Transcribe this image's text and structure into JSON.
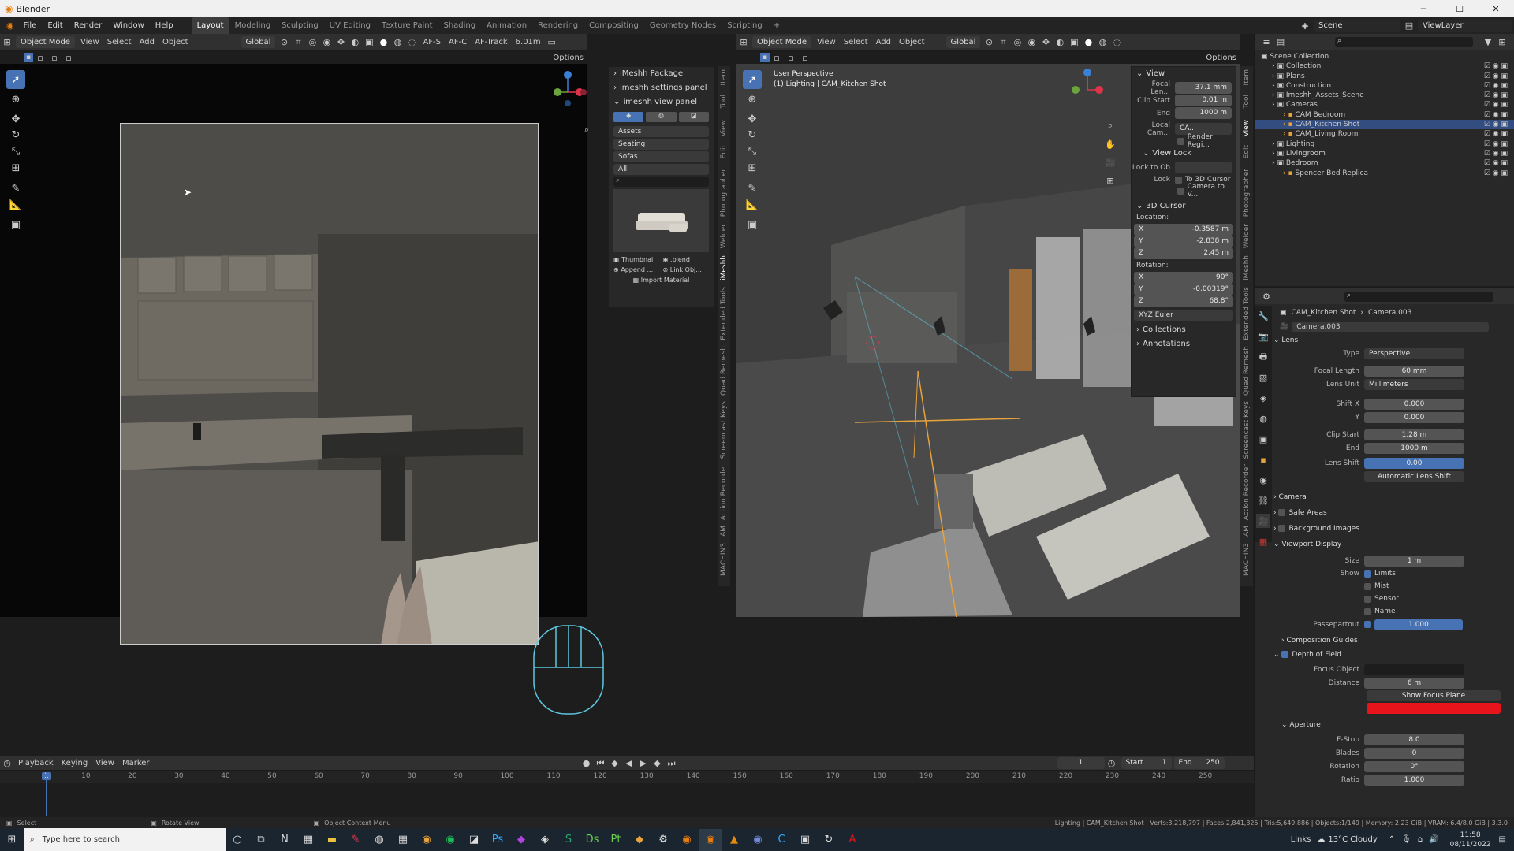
{
  "titlebar": {
    "title": "Blender"
  },
  "menu": [
    "File",
    "Edit",
    "Render",
    "Window",
    "Help"
  ],
  "workspaces": [
    "Layout",
    "Modeling",
    "Sculpting",
    "UV Editing",
    "Texture Paint",
    "Shading",
    "Animation",
    "Rendering",
    "Compositing",
    "Geometry Nodes",
    "Scripting"
  ],
  "active_workspace": "Layout",
  "scene": {
    "name": "Scene",
    "view_layer": "ViewLayer"
  },
  "left_view": {
    "mode": "Object Mode",
    "menus": [
      "View",
      "Select",
      "Add",
      "Object"
    ],
    "transform": "Global",
    "af_labels": [
      "AF-S",
      "AF-C",
      "AF-Track"
    ],
    "af_distance": "6.01m",
    "options": "Options"
  },
  "imeshh": {
    "package": "iMeshh Package",
    "settings": "imeshh settings panel",
    "view_panel": "imeshh view panel",
    "dropdowns": [
      "Assets",
      "Seating",
      "Sofas",
      "All"
    ],
    "thumbnail": "Thumbnail",
    "blend": ".blend",
    "append": "Append ...",
    "link": "Link Obj...",
    "import": "Import Material"
  },
  "left_vtabs": [
    "Item",
    "Tool",
    "View",
    "Edit",
    "Photographer",
    "Welder",
    "iMeshh",
    "Extended Tools",
    "Quad Remesh",
    "Screencast Keys",
    "Action Recorder",
    "AM",
    "MACHIN3"
  ],
  "right_view": {
    "mode": "Object Mode",
    "menus": [
      "View",
      "Select",
      "Add",
      "Object"
    ],
    "transform": "Global",
    "options": "Options",
    "overlay_title": "User Perspective",
    "overlay_sub": "(1) Lighting | CAM_Kitchen Shot"
  },
  "view_panel": {
    "view": "View",
    "focal_label": "Focal Len...",
    "focal": "37.1 mm",
    "clip_start_label": "Clip Start",
    "clip_start": "0.01 m",
    "end_label": "End",
    "end": "1000 m",
    "local_cam": "Local Cam...",
    "local_cam_val": "CA...",
    "render_region": "Render Regi...",
    "view_lock": "View Lock",
    "lock_to_obj": "Lock to Ob",
    "lock": "Lock",
    "to_3d_cursor": "To 3D Cursor",
    "camera_to_view": "Camera to V...",
    "cursor": "3D Cursor",
    "location": "Location:",
    "loc_x": "-0.3587 m",
    "loc_y": "-2.838 m",
    "loc_z": "2.45 m",
    "rotation": "Rotation:",
    "rot_x": "90°",
    "rot_y": "-0.00319°",
    "rot_z": "68.8°",
    "euler": "XYZ Euler",
    "collections": "Collections",
    "annotations": "Annotations"
  },
  "right_vtabs": [
    "Item",
    "Tool",
    "View",
    "Edit",
    "Photographer",
    "Welder",
    "iMeshh",
    "Extended Tools",
    "Quad Remesh",
    "Screencast Keys",
    "Action Recorder",
    "AM",
    "MACHIN3"
  ],
  "outliner": {
    "root": "Scene Collection",
    "rows": [
      {
        "label": "Collection",
        "indent": 1
      },
      {
        "label": "Plans",
        "indent": 1
      },
      {
        "label": "Construction",
        "indent": 1
      },
      {
        "label": "Imeshh_Assets_Scene",
        "indent": 1
      },
      {
        "label": "Cameras",
        "indent": 1
      },
      {
        "label": "CAM Bedroom",
        "indent": 2
      },
      {
        "label": "CAM_Kitchen Shot",
        "indent": 2
      },
      {
        "label": "CAM_Living Room",
        "indent": 2
      },
      {
        "label": "Lighting",
        "indent": 1
      },
      {
        "label": "Livingroom",
        "indent": 1
      },
      {
        "label": "Bedroom",
        "indent": 1
      },
      {
        "label": "Spencer Bed Replica",
        "indent": 2
      }
    ]
  },
  "properties": {
    "breadcrumb_obj": "CAM_Kitchen Shot",
    "breadcrumb_data": "Camera.003",
    "data_name": "Camera.003",
    "lens": "Lens",
    "type_label": "Type",
    "type": "Perspective",
    "focal_label": "Focal Length",
    "focal": "60 mm",
    "lens_unit_label": "Lens Unit",
    "lens_unit": "Millimeters",
    "shift_x_label": "Shift X",
    "shift_x": "0.000",
    "shift_y_label": "Y",
    "shift_y": "0.000",
    "clip_start_label": "Clip Start",
    "clip_start": "1.28 m",
    "clip_end_label": "End",
    "clip_end": "1000 m",
    "lens_shift_label": "Lens Shift",
    "lens_shift": "0.00",
    "auto_shift": "Automatic Lens Shift",
    "camera": "Camera",
    "safe_areas": "Safe Areas",
    "bg_images": "Background Images",
    "viewport_display": "Viewport Display",
    "size_label": "Size",
    "size": "1 m",
    "show_label": "Show",
    "limits": "Limits",
    "mist": "Mist",
    "sensor": "Sensor",
    "name": "Name",
    "passepartout_label": "Passepartout",
    "passepartout": "1.000",
    "comp_guides": "Composition Guides",
    "dof": "Depth of Field",
    "focus_obj_label": "Focus Object",
    "distance_label": "Distance",
    "distance": "6 m",
    "show_focus": "Show Focus Plane",
    "aperture": "Aperture",
    "fstop_label": "F-Stop",
    "fstop": "8.0",
    "blades_label": "Blades",
    "blades": "0",
    "rotation_label": "Rotation",
    "rotation": "0°",
    "ratio_label": "Ratio",
    "ratio": "1.000"
  },
  "timeline": {
    "menus": [
      "Playback",
      "Keying",
      "View",
      "Marker"
    ],
    "current": "1",
    "start_label": "Start",
    "start": "1",
    "end_label": "End",
    "end": "250",
    "ticks": [
      "1",
      "10",
      "20",
      "30",
      "40",
      "50",
      "60",
      "70",
      "80",
      "90",
      "100",
      "110",
      "120",
      "130",
      "140",
      "150",
      "160",
      "170",
      "180",
      "190",
      "200",
      "210",
      "220",
      "230",
      "240",
      "250"
    ]
  },
  "statusbar": {
    "select": "Select",
    "rotate": "Rotate View",
    "context": "Object Context Menu",
    "stats": "Lighting | CAM_Kitchen Shot | Verts:3,218,797 | Faces:2,841,325 | Tris:5,649,886 | Objects:1/149 | Memory: 2.23 GiB | VRAM: 6.4/8.0 GiB | 3.3.0"
  },
  "taskbar": {
    "search_placeholder": "Type here to search",
    "links": "Links",
    "weather": "13°C  Cloudy",
    "time": "11:58",
    "date": "08/11/2022"
  },
  "colors": {
    "accent": "#4772b3",
    "red_field": "#e8141b",
    "orange": "#e8a33c",
    "green": "#6ba33c"
  }
}
